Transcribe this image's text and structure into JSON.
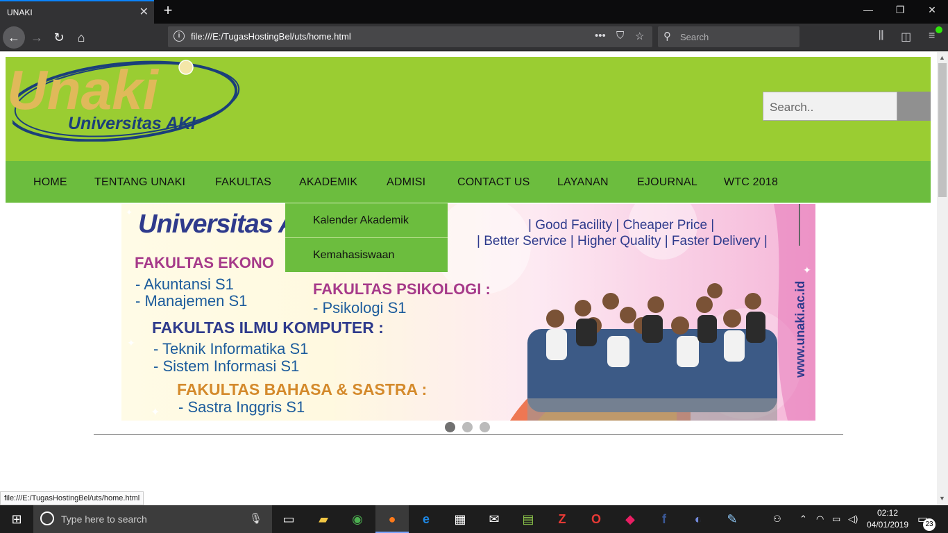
{
  "browser": {
    "tab_title": "UNAKI",
    "tab_close": "✕",
    "new_tab": "+",
    "url": "file:///E:/TugasHostingBel/uts/home.html",
    "search_placeholder": "Search",
    "status_text": "file:///E:/TugasHostingBel/uts/home.html",
    "window_controls": [
      "—",
      "❐",
      "✕"
    ]
  },
  "site": {
    "logo_word": "Unaki",
    "logo_sub": "Universitas AKI",
    "search_placeholder": "Search..",
    "menu": [
      "HOME",
      "TENTANG UNAKI",
      "FAKULTAS",
      "AKADEMIK",
      "ADMISI",
      "CONTACT US",
      "LAYANAN",
      "EJOURNAL",
      "WTC 2018"
    ],
    "dropdown": [
      "Kalender Akademik",
      "Kemahasiswaan"
    ],
    "slide_count": 3,
    "active_slide": 0
  },
  "banner": {
    "brand": "Universitas A",
    "tagline1": "| Good Facility | Cheaper Price |",
    "tagline2": "| Better Service | Higher Quality | Faster Delivery |",
    "fac_eko": "FAKULTAS EKONO",
    "eko_1": "- Akuntansi S1",
    "eko_2": "- Manajemen S1",
    "fac_psi": "FAKULTAS PSIKOLOGI :",
    "psi_1": "- Psikologi S1",
    "fac_ilkom": "FAKULTAS ILMU KOMPUTER :",
    "ilkom_1": "- Teknik Informatika S1",
    "ilkom_2": "- Sistem Informasi S1",
    "fac_bahasa": "FAKULTAS BAHASA & SASTRA :",
    "bahasa_1": "- Sastra Inggris S1",
    "website": "www.unaki.ac.id"
  },
  "taskbar": {
    "search_placeholder": "Type here to search",
    "time": "02:12",
    "date": "04/01/2019",
    "notifications": "23"
  },
  "colors": {
    "header_green": "#9acd32",
    "menu_green": "#6cbd3e",
    "logo_gold": "#e0b95a",
    "logo_navy": "#1b3f7a"
  }
}
